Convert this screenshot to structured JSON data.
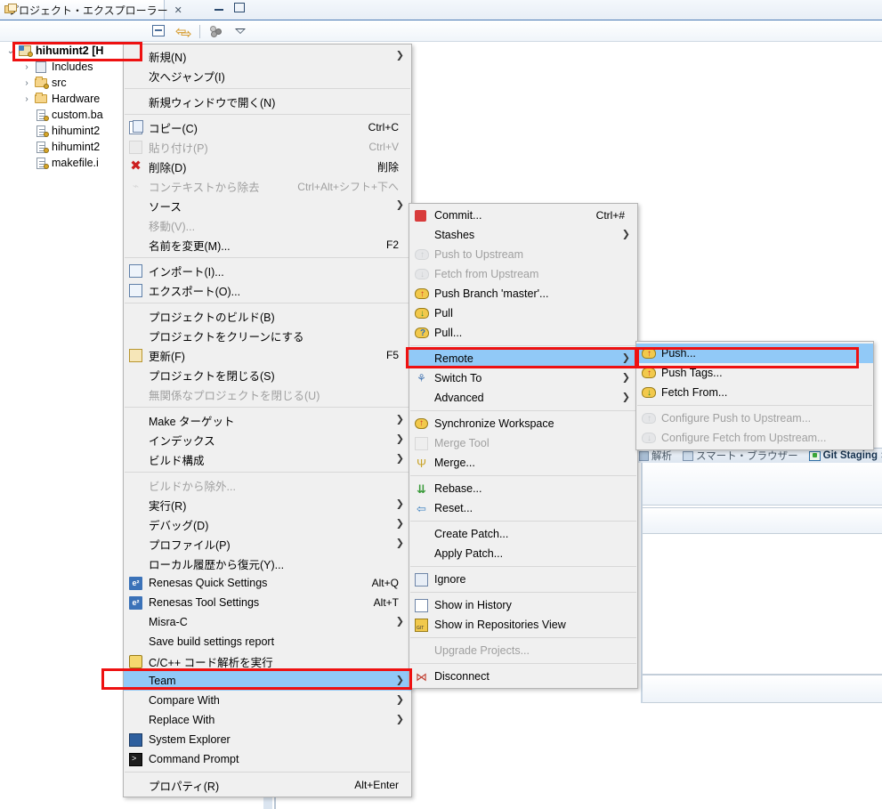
{
  "window": {
    "view_tab": {
      "title": "プロジェクト・エクスプローラー",
      "close_glyph": "✕",
      "icon": "project-explorer-icon"
    },
    "controls": {
      "minimize": "minimize-icon",
      "maximize": "maximize-icon"
    },
    "toolbar": {
      "collapse_all": "collapse-all-icon",
      "link_with_editor": "link-with-editor-icon",
      "focus_on_active_task": "focus-on-active-task-icon",
      "view_menu": "view-menu-icon"
    }
  },
  "tree": {
    "items": [
      {
        "label": "hihumint2 [H",
        "indent": 0,
        "twisty": "v",
        "icon": "project-icon",
        "selected": true
      },
      {
        "label": "Includes",
        "indent": 1,
        "twisty": ">",
        "icon": "includes-icon",
        "selected": false
      },
      {
        "label": "src",
        "indent": 1,
        "twisty": ">",
        "icon": "source-folder-icon",
        "selected": false
      },
      {
        "label": "Hardware",
        "indent": 1,
        "twisty": ">",
        "icon": "folder-icon",
        "selected": false
      },
      {
        "label": "custom.ba",
        "indent": 1,
        "twisty": "",
        "icon": "file-icon",
        "selected": false
      },
      {
        "label": "hihumint2",
        "indent": 1,
        "twisty": "",
        "icon": "file-icon",
        "selected": false
      },
      {
        "label": "hihumint2",
        "indent": 1,
        "twisty": "",
        "icon": "file-icon",
        "selected": false
      },
      {
        "label": "makefile.i",
        "indent": 1,
        "twisty": "",
        "icon": "file-icon",
        "selected": false
      }
    ]
  },
  "context_menu": {
    "items": [
      {
        "label": "新規(N)",
        "accel": "",
        "arrow": true,
        "icon": "",
        "disabled": false
      },
      {
        "label": "次へジャンプ(I)",
        "accel": "",
        "arrow": false,
        "icon": "",
        "disabled": false
      },
      {
        "separator": true
      },
      {
        "label": "新規ウィンドウで開く(N)",
        "accel": "",
        "arrow": false,
        "icon": "",
        "disabled": false
      },
      {
        "separator": true
      },
      {
        "label": "コピー(C)",
        "accel": "Ctrl+C",
        "arrow": false,
        "icon": "copy-icon",
        "disabled": false
      },
      {
        "label": "貼り付け(P)",
        "accel": "Ctrl+V",
        "arrow": false,
        "icon": "paste-icon",
        "disabled": true
      },
      {
        "label": "削除(D)",
        "accel": "削除",
        "arrow": false,
        "icon": "delete-icon",
        "disabled": false
      },
      {
        "label": "コンテキストから除去",
        "accel": "Ctrl+Alt+シフト+下へ",
        "arrow": false,
        "icon": "remove-from-context-icon",
        "disabled": true
      },
      {
        "label": "ソース",
        "accel": "",
        "arrow": true,
        "icon": "",
        "disabled": false
      },
      {
        "label": "移動(V)...",
        "accel": "",
        "arrow": false,
        "icon": "",
        "disabled": true
      },
      {
        "label": "名前を変更(M)...",
        "accel": "F2",
        "arrow": false,
        "icon": "",
        "disabled": false
      },
      {
        "separator": true
      },
      {
        "label": "インポート(I)...",
        "accel": "",
        "arrow": false,
        "icon": "import-icon",
        "disabled": false
      },
      {
        "label": "エクスポート(O)...",
        "accel": "",
        "arrow": false,
        "icon": "export-icon",
        "disabled": false
      },
      {
        "separator": true
      },
      {
        "label": "プロジェクトのビルド(B)",
        "accel": "",
        "arrow": false,
        "icon": "",
        "disabled": false
      },
      {
        "label": "プロジェクトをクリーンにする",
        "accel": "",
        "arrow": false,
        "icon": "",
        "disabled": false
      },
      {
        "label": "更新(F)",
        "accel": "F5",
        "arrow": false,
        "icon": "refresh-icon",
        "disabled": false
      },
      {
        "label": "プロジェクトを閉じる(S)",
        "accel": "",
        "arrow": false,
        "icon": "",
        "disabled": false
      },
      {
        "label": "無関係なプロジェクトを閉じる(U)",
        "accel": "",
        "arrow": false,
        "icon": "",
        "disabled": true
      },
      {
        "separator": true
      },
      {
        "label": "Make ターゲット",
        "accel": "",
        "arrow": true,
        "icon": "",
        "disabled": false
      },
      {
        "label": "インデックス",
        "accel": "",
        "arrow": true,
        "icon": "",
        "disabled": false
      },
      {
        "label": "ビルド構成",
        "accel": "",
        "arrow": true,
        "icon": "",
        "disabled": false
      },
      {
        "separator": true
      },
      {
        "label": "ビルドから除外...",
        "accel": "",
        "arrow": false,
        "icon": "",
        "disabled": true
      },
      {
        "label": "実行(R)",
        "accel": "",
        "arrow": true,
        "icon": "",
        "disabled": false
      },
      {
        "label": "デバッグ(D)",
        "accel": "",
        "arrow": true,
        "icon": "",
        "disabled": false
      },
      {
        "label": "プロファイル(P)",
        "accel": "",
        "arrow": true,
        "icon": "",
        "disabled": false
      },
      {
        "label": "ローカル履歴から復元(Y)...",
        "accel": "",
        "arrow": false,
        "icon": "",
        "disabled": false
      },
      {
        "label": "Renesas Quick Settings",
        "accel": "Alt+Q",
        "arrow": false,
        "icon": "renesas-icon",
        "disabled": false
      },
      {
        "label": "Renesas Tool Settings",
        "accel": "Alt+T",
        "arrow": false,
        "icon": "renesas-icon",
        "disabled": false
      },
      {
        "label": "Misra-C",
        "accel": "",
        "arrow": true,
        "icon": "",
        "disabled": false
      },
      {
        "label": "Save build settings report",
        "accel": "",
        "arrow": false,
        "icon": "",
        "disabled": false
      },
      {
        "label": "C/C++ コード解析を実行",
        "accel": "",
        "arrow": false,
        "icon": "code-analysis-icon",
        "disabled": false
      },
      {
        "label": "Team",
        "accel": "",
        "arrow": true,
        "icon": "",
        "disabled": false,
        "selected": true
      },
      {
        "label": "Compare With",
        "accel": "",
        "arrow": true,
        "icon": "",
        "disabled": false
      },
      {
        "label": "Replace With",
        "accel": "",
        "arrow": true,
        "icon": "",
        "disabled": false
      },
      {
        "label": "System Explorer",
        "accel": "",
        "arrow": false,
        "icon": "system-explorer-icon",
        "disabled": false
      },
      {
        "label": "Command Prompt",
        "accel": "",
        "arrow": false,
        "icon": "command-prompt-icon",
        "disabled": false
      },
      {
        "separator": true
      },
      {
        "label": "プロパティ(R)",
        "accel": "Alt+Enter",
        "arrow": false,
        "icon": "",
        "disabled": false
      }
    ]
  },
  "team_menu": {
    "items": [
      {
        "label": "Commit...",
        "accel": "Ctrl+#",
        "arrow": false,
        "icon": "commit-icon",
        "disabled": false
      },
      {
        "label": "Stashes",
        "accel": "",
        "arrow": true,
        "icon": "",
        "disabled": false
      },
      {
        "label": "Push to Upstream",
        "accel": "",
        "arrow": false,
        "icon": "push-upstream-icon",
        "disabled": true
      },
      {
        "label": "Fetch from Upstream",
        "accel": "",
        "arrow": false,
        "icon": "fetch-upstream-icon",
        "disabled": true
      },
      {
        "label": "Push Branch 'master'...",
        "accel": "",
        "arrow": false,
        "icon": "push-branch-icon",
        "disabled": false
      },
      {
        "label": "Pull",
        "accel": "",
        "arrow": false,
        "icon": "pull-icon",
        "disabled": false
      },
      {
        "label": "Pull...",
        "accel": "",
        "arrow": false,
        "icon": "pull-options-icon",
        "disabled": false
      },
      {
        "separator": true
      },
      {
        "label": "Remote",
        "accel": "",
        "arrow": true,
        "icon": "",
        "disabled": false,
        "selected": true
      },
      {
        "label": "Switch To",
        "accel": "",
        "arrow": true,
        "icon": "switch-to-icon",
        "disabled": false
      },
      {
        "label": "Advanced",
        "accel": "",
        "arrow": true,
        "icon": "",
        "disabled": false
      },
      {
        "separator": true
      },
      {
        "label": "Synchronize Workspace",
        "accel": "",
        "arrow": false,
        "icon": "synchronize-icon",
        "disabled": false
      },
      {
        "label": "Merge Tool",
        "accel": "",
        "arrow": false,
        "icon": "merge-tool-icon",
        "disabled": true
      },
      {
        "label": "Merge...",
        "accel": "",
        "arrow": false,
        "icon": "merge-icon",
        "disabled": false
      },
      {
        "separator": true
      },
      {
        "label": "Rebase...",
        "accel": "",
        "arrow": false,
        "icon": "rebase-icon",
        "disabled": false
      },
      {
        "label": "Reset...",
        "accel": "",
        "arrow": false,
        "icon": "reset-icon",
        "disabled": false
      },
      {
        "separator": true
      },
      {
        "label": "Create Patch...",
        "accel": "",
        "arrow": false,
        "icon": "",
        "disabled": false
      },
      {
        "label": "Apply Patch...",
        "accel": "",
        "arrow": false,
        "icon": "",
        "disabled": false
      },
      {
        "separator": true
      },
      {
        "label": "Ignore",
        "accel": "",
        "arrow": false,
        "icon": "ignore-icon",
        "disabled": false
      },
      {
        "separator": true
      },
      {
        "label": "Show in History",
        "accel": "",
        "arrow": false,
        "icon": "history-icon",
        "disabled": false
      },
      {
        "label": "Show in Repositories View",
        "accel": "",
        "arrow": false,
        "icon": "repositories-icon",
        "disabled": false
      },
      {
        "separator": true
      },
      {
        "label": "Upgrade Projects...",
        "accel": "",
        "arrow": false,
        "icon": "",
        "disabled": true
      },
      {
        "separator": true
      },
      {
        "label": "Disconnect",
        "accel": "",
        "arrow": false,
        "icon": "disconnect-icon",
        "disabled": false
      }
    ]
  },
  "remote_menu": {
    "items": [
      {
        "label": "Push...",
        "accel": "",
        "arrow": false,
        "icon": "push-icon",
        "disabled": false,
        "selected": true
      },
      {
        "label": "Push Tags...",
        "accel": "",
        "arrow": false,
        "icon": "push-tags-icon",
        "disabled": false
      },
      {
        "label": "Fetch From...",
        "accel": "",
        "arrow": false,
        "icon": "fetch-from-icon",
        "disabled": false
      },
      {
        "separator": true
      },
      {
        "label": "Configure Push to Upstream...",
        "accel": "",
        "arrow": false,
        "icon": "configure-push-icon",
        "disabled": true
      },
      {
        "label": "Configure Fetch from Upstream...",
        "accel": "",
        "arrow": false,
        "icon": "configure-fetch-icon",
        "disabled": true
      }
    ]
  },
  "background": {
    "bottom_tabs": [
      {
        "label": "解析",
        "icon": "analysis-icon",
        "active": false
      },
      {
        "label": "スマート・ブラウザー",
        "icon": "smart-browser-icon",
        "active": false
      },
      {
        "label": "Git Staging",
        "icon": "git-staging-icon",
        "active": true,
        "close_glyph": "✕"
      }
    ]
  },
  "annotations": {
    "highlight_color": "#ee1111",
    "selection_color": "#91c9f7",
    "boxes": [
      {
        "name": "project-node-box"
      },
      {
        "name": "team-item-box"
      },
      {
        "name": "remote-item-box"
      },
      {
        "name": "push-item-box"
      }
    ]
  }
}
